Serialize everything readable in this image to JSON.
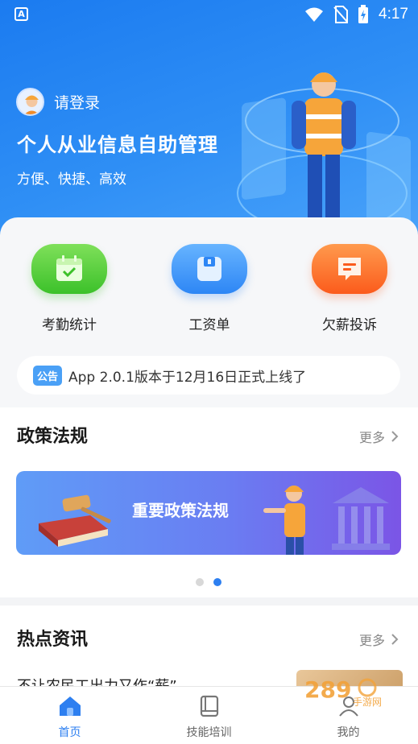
{
  "status_bar": {
    "time": "4:17"
  },
  "hero": {
    "login_text": "请登录",
    "title": "个人从业信息自助管理",
    "subtitle": "方便、快捷、高效"
  },
  "quick_actions": [
    {
      "label": "考勤统计",
      "icon": "calendar-check-icon",
      "color": "#3cc12a"
    },
    {
      "label": "工资单",
      "icon": "wallet-icon",
      "color": "#2d86f5"
    },
    {
      "label": "欠薪投诉",
      "icon": "complaint-doc-icon",
      "color": "#fb5b1c"
    }
  ],
  "notice": {
    "tag": "公告",
    "text": "App 2.0.1版本于12月16日正式上线了"
  },
  "policy": {
    "title": "政策法规",
    "more": "更多",
    "banner_text": "重要政策法规",
    "carousel": {
      "count": 2,
      "active": 2
    }
  },
  "news": {
    "title": "热点资讯",
    "more": "更多",
    "first_item": "不让农民工出力又作“薪”"
  },
  "watermark": "2 8 9 手游网",
  "tabs": [
    {
      "label": "首页",
      "icon": "home-icon",
      "active": true
    },
    {
      "label": "技能培训",
      "icon": "book-icon",
      "active": false
    },
    {
      "label": "我的",
      "icon": "person-icon",
      "active": false
    }
  ],
  "colors": {
    "primary": "#2d7ff0",
    "hero_bg": "#2f8ff5"
  }
}
